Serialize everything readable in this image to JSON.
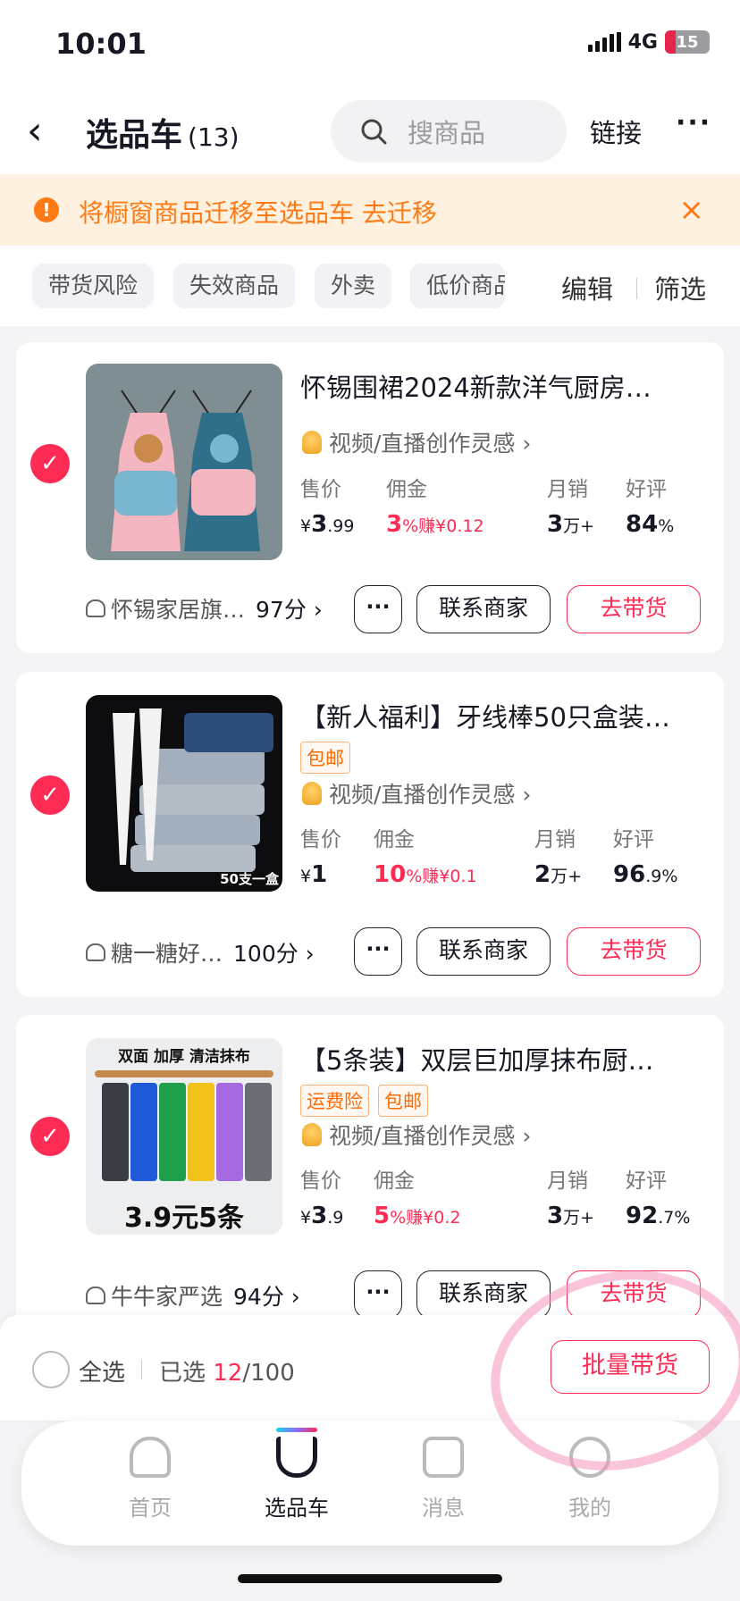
{
  "status": {
    "time": "10:01",
    "network": "4G",
    "battery": "15"
  },
  "header": {
    "title": "选品车",
    "count": "(13)",
    "search_placeholder": "搜商品",
    "link_label": "链接",
    "more": "···"
  },
  "banner": {
    "message": "将橱窗商品迁移至选品车",
    "action": "去迁移",
    "close": "×"
  },
  "filters": {
    "chips": [
      "带货风险",
      "失效商品",
      "外卖",
      "低价商品"
    ],
    "edit": "编辑",
    "filter": "筛选"
  },
  "labels": {
    "price": "售价",
    "commission": "佣金",
    "monthly_sales": "月销",
    "rating": "好评",
    "inspiration": "视频/直播创作灵感 ›",
    "more_btn": "···",
    "contact": "联系商家",
    "promote": "去带货"
  },
  "products": [
    {
      "title": "怀锡围裙2024新款洋气厨房…",
      "tags": [],
      "price_symbol": "¥",
      "price_int": "3",
      "price_dec": ".99",
      "commission_pct": "3",
      "commission_earn": "赚¥0.12",
      "sales_num": "3",
      "sales_unit": "万+",
      "rating_int": "84",
      "rating_dec": "%",
      "shop": "怀锡家居旗…",
      "shop_score": "97分 ›"
    },
    {
      "title": "【新人福利】牙线棒50只盒装…",
      "tags": [
        "包邮"
      ],
      "price_symbol": "¥",
      "price_int": "1",
      "price_dec": "",
      "commission_pct": "10",
      "commission_earn": "赚¥0.1",
      "sales_num": "2",
      "sales_unit": "万+",
      "rating_int": "96",
      "rating_dec": ".9%",
      "shop": "糖一糖好…",
      "shop_score": "100分 ›",
      "image_caption": "50支一盒"
    },
    {
      "title": "【5条装】双层巨加厚抹布厨…",
      "tags": [
        "运费险",
        "包邮"
      ],
      "price_symbol": "¥",
      "price_int": "3",
      "price_dec": ".9",
      "commission_pct": "5",
      "commission_earn": "赚¥0.2",
      "sales_num": "3",
      "sales_unit": "万+",
      "rating_int": "92",
      "rating_dec": ".7%",
      "shop": "牛牛家严选",
      "shop_score": "94分 ›",
      "image_top": "双面  加厚  清洁抹布",
      "image_bottom": "3.9元5条"
    }
  ],
  "selection": {
    "select_all": "全选",
    "selected_prefix": "已选 ",
    "selected": "12",
    "total": "/100",
    "batch": "批量带货"
  },
  "tabbar": {
    "tabs": [
      "首页",
      "选品车",
      "消息",
      "我的"
    ],
    "active": 1
  },
  "colors": {
    "accent": "#fe2c55",
    "warning": "#ff7a14"
  }
}
